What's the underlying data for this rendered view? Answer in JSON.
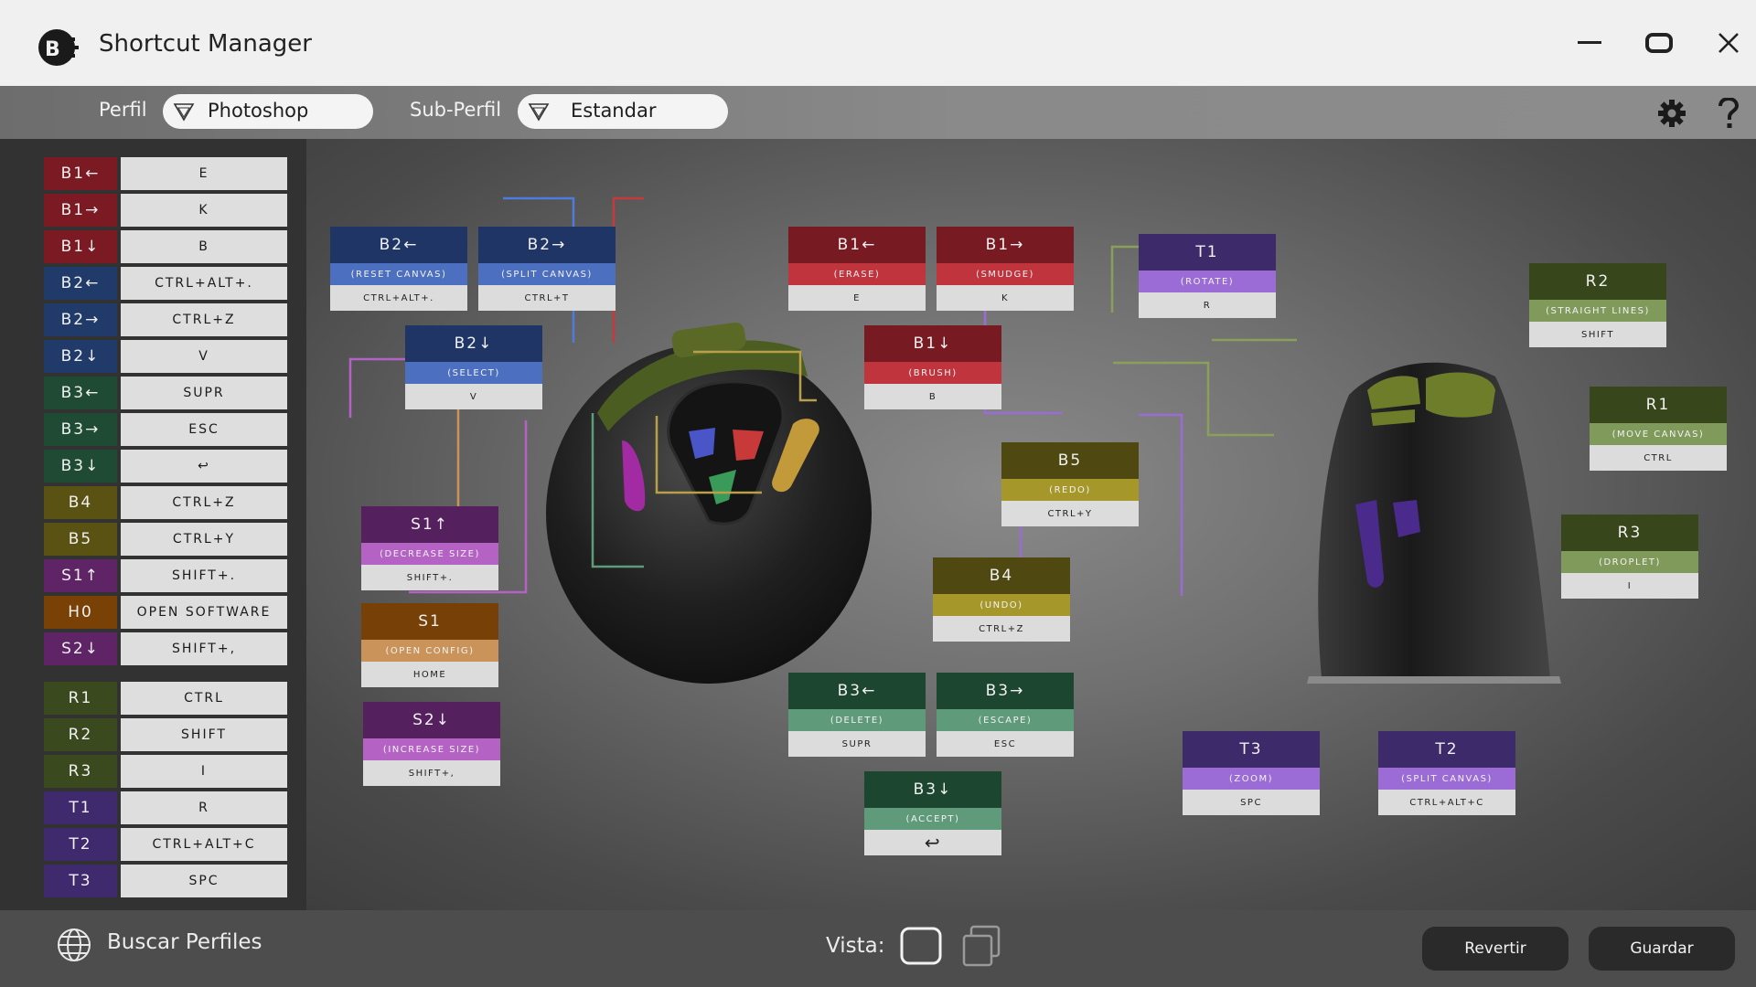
{
  "app": {
    "title": "Shortcut Manager"
  },
  "toolbar": {
    "profile_label": "Perfil",
    "profile_value": "Photoshop",
    "subprofile_label": "Sub-Perfil",
    "subprofile_value": "Estandar"
  },
  "sidebar": {
    "rows": [
      {
        "key": "B1←",
        "value": "E",
        "color": "#7c1a24"
      },
      {
        "key": "B1→",
        "value": "K",
        "color": "#7c1a24"
      },
      {
        "key": "B1↓",
        "value": "B",
        "color": "#7c1a24"
      },
      {
        "key": "B2←",
        "value": "CTRL+ALT+.",
        "color": "#203a6a"
      },
      {
        "key": "B2→",
        "value": "CTRL+Z",
        "color": "#203a6a"
      },
      {
        "key": "B2↓",
        "value": "V",
        "color": "#203a6a"
      },
      {
        "key": "B3←",
        "value": "SUPR",
        "color": "#1f4a33"
      },
      {
        "key": "B3→",
        "value": "ESC",
        "color": "#1f4a33"
      },
      {
        "key": "B3↓",
        "value": "↩",
        "color": "#1f4a33"
      },
      {
        "key": "B4",
        "value": "CTRL+Z",
        "color": "#5a5212"
      },
      {
        "key": "B5",
        "value": "CTRL+Y",
        "color": "#5a5212"
      },
      {
        "key": "S1↑",
        "value": "SHIFT+.",
        "color": "#5e2466"
      },
      {
        "key": "H0",
        "value": "OPEN SOFTWARE",
        "color": "#7a4106"
      },
      {
        "key": "S2↓",
        "value": "SHIFT+,",
        "color": "#5e2466"
      },
      {
        "key": "R1",
        "value": "CTRL",
        "color": "#3b4a1e"
      },
      {
        "key": "R2",
        "value": "SHIFT",
        "color": "#3b4a1e"
      },
      {
        "key": "R3",
        "value": "I",
        "color": "#3b4a1e"
      },
      {
        "key": "T1",
        "value": "R",
        "color": "#3f2a6e"
      },
      {
        "key": "T2",
        "value": "CTRL+ALT+C",
        "color": "#3f2a6e"
      },
      {
        "key": "T3",
        "value": "SPC",
        "color": "#3f2a6e"
      }
    ]
  },
  "cards": [
    {
      "id": "b2-left",
      "head": "B2←",
      "desc": "(RESET CANVAS)",
      "key": "CTRL+ALT+.",
      "headColor": "#1e3566",
      "descColor": "#4c6fbf"
    },
    {
      "id": "b2-right",
      "head": "B2→",
      "desc": "(SPLIT CANVAS)",
      "key": "CTRL+T",
      "headColor": "#1e3566",
      "descColor": "#4c6fbf"
    },
    {
      "id": "b2-down",
      "head": "B2↓",
      "desc": "(SELECT)",
      "key": "V",
      "headColor": "#1e3566",
      "descColor": "#4c6fbf"
    },
    {
      "id": "b1-left",
      "head": "B1←",
      "desc": "(ERASE)",
      "key": "E",
      "headColor": "#781a22",
      "descColor": "#c0343e"
    },
    {
      "id": "b1-right",
      "head": "B1→",
      "desc": "(SMUDGE)",
      "key": "K",
      "headColor": "#781a22",
      "descColor": "#c0343e"
    },
    {
      "id": "b1-down",
      "head": "B1↓",
      "desc": "(BRUSH)",
      "key": "B",
      "headColor": "#781a22",
      "descColor": "#c0343e"
    },
    {
      "id": "b5",
      "head": "B5",
      "desc": "(REDO)",
      "key": "CTRL+Y",
      "headColor": "#4f4810",
      "descColor": "#a6972a"
    },
    {
      "id": "b4",
      "head": "B4",
      "desc": "(UNDO)",
      "key": "CTRL+Z",
      "headColor": "#4f4810",
      "descColor": "#a6972a"
    },
    {
      "id": "s1-up",
      "head": "S1↑",
      "desc": "(DECREASE SIZE)",
      "key": "SHIFT+.",
      "headColor": "#55205e",
      "descColor": "#b462c4"
    },
    {
      "id": "s1",
      "head": "S1",
      "desc": "(OPEN CONFIG)",
      "key": "HOME",
      "headColor": "#764006",
      "descColor": "#c9935a"
    },
    {
      "id": "s2-down",
      "head": "S2↓",
      "desc": "(INCREASE SIZE)",
      "key": "SHIFT+,",
      "headColor": "#55205e",
      "descColor": "#b462c4"
    },
    {
      "id": "b3-left",
      "head": "B3←",
      "desc": "(DELETE)",
      "key": "SUPR",
      "headColor": "#1d4630",
      "descColor": "#5f9b7a"
    },
    {
      "id": "b3-right",
      "head": "B3→",
      "desc": "(ESCAPE)",
      "key": "ESC",
      "headColor": "#1d4630",
      "descColor": "#5f9b7a"
    },
    {
      "id": "b3-down",
      "head": "B3↓",
      "desc": "(ACCEPT)",
      "key": "↩",
      "headColor": "#1d4630",
      "descColor": "#5f9b7a"
    },
    {
      "id": "t1",
      "head": "T1",
      "desc": "(ROTATE)",
      "key": "R",
      "headColor": "#3c2a6b",
      "descColor": "#9b6bd6"
    },
    {
      "id": "r2",
      "head": "R2",
      "desc": "(STRAIGHT LINES)",
      "key": "SHIFT",
      "headColor": "#37461b",
      "descColor": "#7f9a5a"
    },
    {
      "id": "r1",
      "head": "R1",
      "desc": "(MOVE CANVAS)",
      "key": "CTRL",
      "headColor": "#37461b",
      "descColor": "#7f9a5a"
    },
    {
      "id": "r3",
      "head": "R3",
      "desc": "(DROPLET)",
      "key": "I",
      "headColor": "#37461b",
      "descColor": "#7f9a5a"
    },
    {
      "id": "t3",
      "head": "T3",
      "desc": "(ZOOM)",
      "key": "SPC",
      "headColor": "#3c2a6b",
      "descColor": "#9b6bd6"
    },
    {
      "id": "t2",
      "head": "T2",
      "desc": "(SPLIT CANVAS)",
      "key": "CTRL+ALT+C",
      "headColor": "#3c2a6b",
      "descColor": "#9b6bd6"
    }
  ],
  "bottom": {
    "search_label": "Buscar Perfiles",
    "view_label": "Vista:",
    "revert_label": "Revertir",
    "save_label": "Guardar"
  },
  "icons": {
    "logo": "logo-icon",
    "minimize": "minimize-icon",
    "maximize": "maximize-icon",
    "close": "close-icon",
    "filter": "filter-icon",
    "settings": "gear-icon",
    "help": "help-icon",
    "globe": "globe-icon",
    "single_view": "single-view-icon",
    "double_view": "double-view-icon"
  }
}
